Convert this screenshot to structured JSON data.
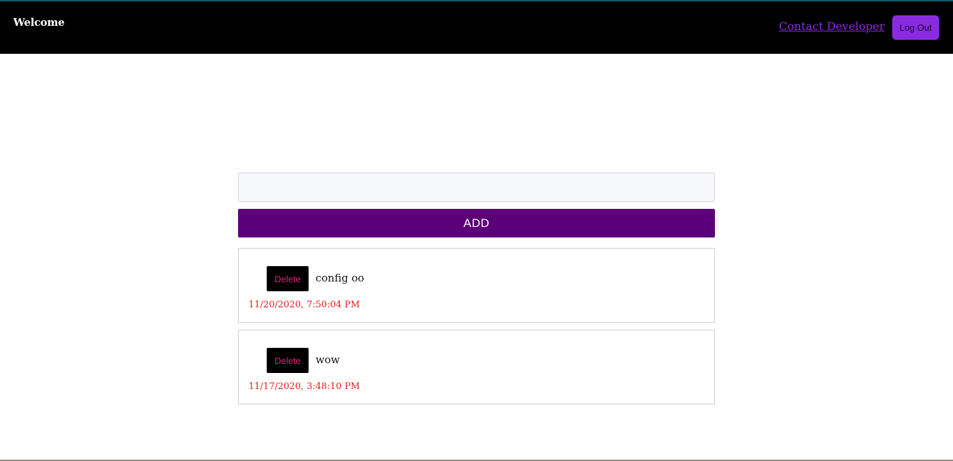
{
  "navbar": {
    "brand": "Welcome",
    "contact_link": "Contact Developer",
    "logout_label": "Log Out"
  },
  "form": {
    "input_value": "",
    "input_placeholder": "",
    "add_label": "ADD"
  },
  "todos": [
    {
      "delete_label": "Delete",
      "text": "config oo",
      "timestamp": "11/20/2020, 7:50:04 PM"
    },
    {
      "delete_label": "Delete",
      "text": "wow",
      "timestamp": "11/17/2020, 3:48:10 PM"
    }
  ],
  "colors": {
    "navbar_bg": "#000000",
    "accent_purple": "#8a2be2",
    "add_button": "#5c0079",
    "delete_text": "#e0207a",
    "timestamp": "#e51c1c"
  }
}
